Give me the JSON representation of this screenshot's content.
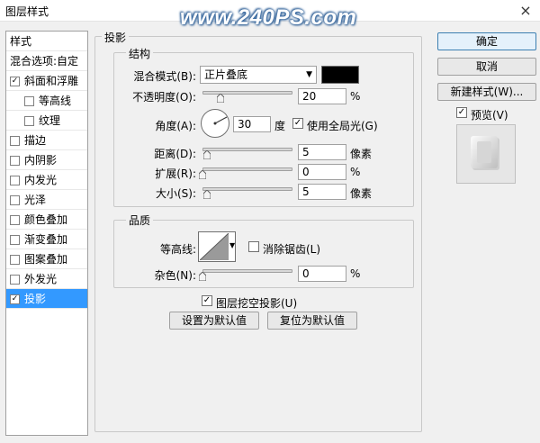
{
  "window": {
    "title": "图层样式",
    "watermark": "www.240PS.com",
    "close": "×"
  },
  "styles_panel": {
    "header": "样式",
    "blend_options": "混合选项:自定",
    "items": [
      {
        "label": "斜面和浮雕",
        "checked": true,
        "indent": false
      },
      {
        "label": "等高线",
        "checked": false,
        "indent": true
      },
      {
        "label": "纹理",
        "checked": false,
        "indent": true
      },
      {
        "label": "描边",
        "checked": false,
        "indent": false
      },
      {
        "label": "内阴影",
        "checked": false,
        "indent": false
      },
      {
        "label": "内发光",
        "checked": false,
        "indent": false
      },
      {
        "label": "光泽",
        "checked": false,
        "indent": false
      },
      {
        "label": "颜色叠加",
        "checked": false,
        "indent": false
      },
      {
        "label": "渐变叠加",
        "checked": false,
        "indent": false
      },
      {
        "label": "图案叠加",
        "checked": false,
        "indent": false
      },
      {
        "label": "外发光",
        "checked": false,
        "indent": false
      },
      {
        "label": "投影",
        "checked": true,
        "indent": false,
        "selected": true
      }
    ]
  },
  "drop_shadow": {
    "section_title": "投影",
    "structure": {
      "title": "结构",
      "blend_mode_label": "混合模式(B):",
      "blend_mode_value": "正片叠底",
      "shadow_color": "#000000",
      "opacity_label": "不透明度(O):",
      "opacity_value": "20",
      "opacity_unit": "%",
      "angle_label": "角度(A):",
      "angle_value": "30",
      "angle_unit": "度",
      "global_light_label": "使用全局光(G)",
      "global_light_checked": true,
      "distance_label": "距离(D):",
      "distance_value": "5",
      "distance_unit": "像素",
      "spread_label": "扩展(R):",
      "spread_value": "0",
      "spread_unit": "%",
      "size_label": "大小(S):",
      "size_value": "5",
      "size_unit": "像素"
    },
    "quality": {
      "title": "品质",
      "contour_label": "等高线:",
      "anti_alias_label": "消除锯齿(L)",
      "anti_alias_checked": false,
      "noise_label": "杂色(N):",
      "noise_value": "0",
      "noise_unit": "%"
    },
    "knockout_label": "图层挖空投影(U)",
    "knockout_checked": true,
    "make_default": "设置为默认值",
    "reset_default": "复位为默认值"
  },
  "actions": {
    "ok": "确定",
    "cancel": "取消",
    "new_style": "新建样式(W)...",
    "preview_label": "预览(V)",
    "preview_checked": true
  },
  "sliders": {
    "opacity": 0.2,
    "distance": 0.05,
    "spread": 0.0,
    "size": 0.05,
    "noise": 0.0
  },
  "colors": {
    "accent": "#3399ff",
    "border": "#a0a0a0",
    "panel": "#f0f0f0"
  }
}
